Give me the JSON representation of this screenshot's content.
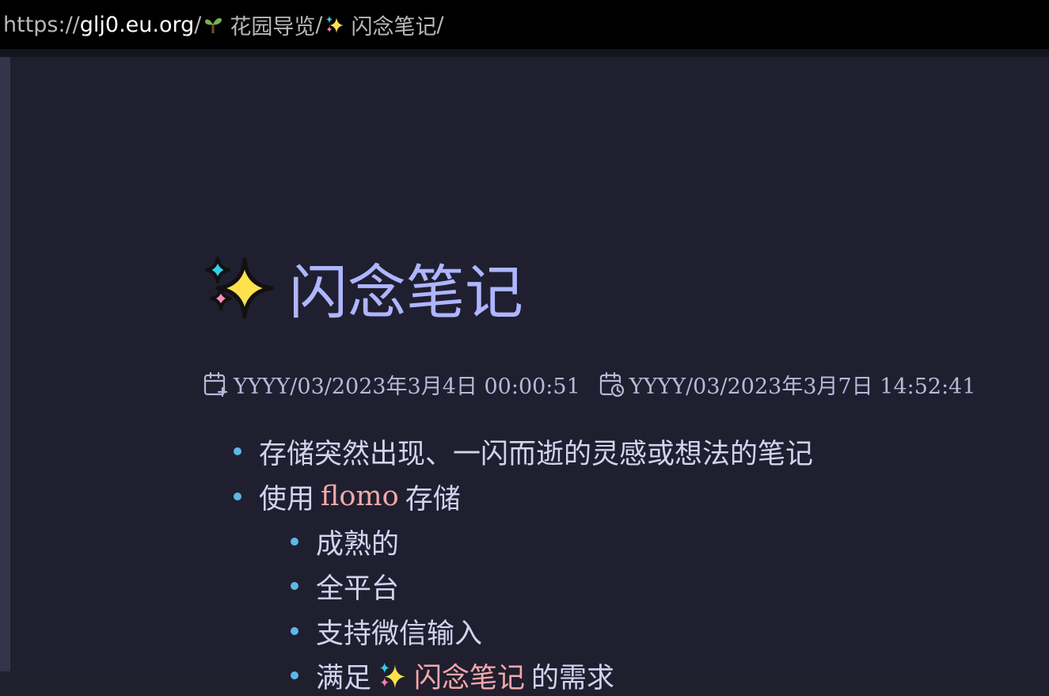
{
  "urlbar": {
    "scheme": "https://",
    "host": "glj0.eu.org",
    "separator": "/",
    "crumbs": [
      {
        "icon": "seedling-icon",
        "label": "花园导览"
      },
      {
        "icon": "sparkles-icon",
        "label": "闪念笔记"
      }
    ],
    "trailing": "/"
  },
  "page": {
    "title_icon": "sparkles-icon",
    "title": "闪念笔记",
    "created_icon": "calendar-plus-icon",
    "created": "YYYY/03/2023年3月4日 00:00:51",
    "updated_icon": "calendar-clock-icon",
    "updated": "YYYY/03/2023年3月7日 14:52:41"
  },
  "list": {
    "item1": "存储突然出现、一闪而逝的灵感或想法的笔记",
    "item2_prefix": "使用",
    "item2_link": "flomo",
    "item2_suffix": "存储",
    "sub": [
      "成熟的",
      "全平台",
      "支持微信输入"
    ],
    "sub4_prefix": "满足",
    "sub4_link": "闪念笔记",
    "sub4_suffix": "的需求"
  },
  "colors": {
    "background": "#1f1f30",
    "title": "#aeb6ff",
    "text": "#d2d3ee",
    "link": "#f4a8a8",
    "bullet": "#5cb8e6"
  }
}
